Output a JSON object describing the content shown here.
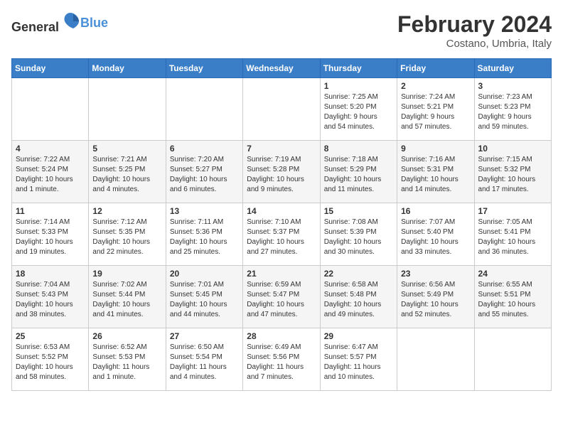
{
  "header": {
    "logo": {
      "text_general": "General",
      "text_blue": "Blue"
    },
    "title": "February 2024",
    "location": "Costano, Umbria, Italy"
  },
  "weekdays": [
    "Sunday",
    "Monday",
    "Tuesday",
    "Wednesday",
    "Thursday",
    "Friday",
    "Saturday"
  ],
  "weeks": [
    [
      {
        "day": "",
        "content": ""
      },
      {
        "day": "",
        "content": ""
      },
      {
        "day": "",
        "content": ""
      },
      {
        "day": "",
        "content": ""
      },
      {
        "day": "1",
        "content": "Sunrise: 7:25 AM\nSunset: 5:20 PM\nDaylight: 9 hours\nand 54 minutes."
      },
      {
        "day": "2",
        "content": "Sunrise: 7:24 AM\nSunset: 5:21 PM\nDaylight: 9 hours\nand 57 minutes."
      },
      {
        "day": "3",
        "content": "Sunrise: 7:23 AM\nSunset: 5:23 PM\nDaylight: 9 hours\nand 59 minutes."
      }
    ],
    [
      {
        "day": "4",
        "content": "Sunrise: 7:22 AM\nSunset: 5:24 PM\nDaylight: 10 hours\nand 1 minute."
      },
      {
        "day": "5",
        "content": "Sunrise: 7:21 AM\nSunset: 5:25 PM\nDaylight: 10 hours\nand 4 minutes."
      },
      {
        "day": "6",
        "content": "Sunrise: 7:20 AM\nSunset: 5:27 PM\nDaylight: 10 hours\nand 6 minutes."
      },
      {
        "day": "7",
        "content": "Sunrise: 7:19 AM\nSunset: 5:28 PM\nDaylight: 10 hours\nand 9 minutes."
      },
      {
        "day": "8",
        "content": "Sunrise: 7:18 AM\nSunset: 5:29 PM\nDaylight: 10 hours\nand 11 minutes."
      },
      {
        "day": "9",
        "content": "Sunrise: 7:16 AM\nSunset: 5:31 PM\nDaylight: 10 hours\nand 14 minutes."
      },
      {
        "day": "10",
        "content": "Sunrise: 7:15 AM\nSunset: 5:32 PM\nDaylight: 10 hours\nand 17 minutes."
      }
    ],
    [
      {
        "day": "11",
        "content": "Sunrise: 7:14 AM\nSunset: 5:33 PM\nDaylight: 10 hours\nand 19 minutes."
      },
      {
        "day": "12",
        "content": "Sunrise: 7:12 AM\nSunset: 5:35 PM\nDaylight: 10 hours\nand 22 minutes."
      },
      {
        "day": "13",
        "content": "Sunrise: 7:11 AM\nSunset: 5:36 PM\nDaylight: 10 hours\nand 25 minutes."
      },
      {
        "day": "14",
        "content": "Sunrise: 7:10 AM\nSunset: 5:37 PM\nDaylight: 10 hours\nand 27 minutes."
      },
      {
        "day": "15",
        "content": "Sunrise: 7:08 AM\nSunset: 5:39 PM\nDaylight: 10 hours\nand 30 minutes."
      },
      {
        "day": "16",
        "content": "Sunrise: 7:07 AM\nSunset: 5:40 PM\nDaylight: 10 hours\nand 33 minutes."
      },
      {
        "day": "17",
        "content": "Sunrise: 7:05 AM\nSunset: 5:41 PM\nDaylight: 10 hours\nand 36 minutes."
      }
    ],
    [
      {
        "day": "18",
        "content": "Sunrise: 7:04 AM\nSunset: 5:43 PM\nDaylight: 10 hours\nand 38 minutes."
      },
      {
        "day": "19",
        "content": "Sunrise: 7:02 AM\nSunset: 5:44 PM\nDaylight: 10 hours\nand 41 minutes."
      },
      {
        "day": "20",
        "content": "Sunrise: 7:01 AM\nSunset: 5:45 PM\nDaylight: 10 hours\nand 44 minutes."
      },
      {
        "day": "21",
        "content": "Sunrise: 6:59 AM\nSunset: 5:47 PM\nDaylight: 10 hours\nand 47 minutes."
      },
      {
        "day": "22",
        "content": "Sunrise: 6:58 AM\nSunset: 5:48 PM\nDaylight: 10 hours\nand 49 minutes."
      },
      {
        "day": "23",
        "content": "Sunrise: 6:56 AM\nSunset: 5:49 PM\nDaylight: 10 hours\nand 52 minutes."
      },
      {
        "day": "24",
        "content": "Sunrise: 6:55 AM\nSunset: 5:51 PM\nDaylight: 10 hours\nand 55 minutes."
      }
    ],
    [
      {
        "day": "25",
        "content": "Sunrise: 6:53 AM\nSunset: 5:52 PM\nDaylight: 10 hours\nand 58 minutes."
      },
      {
        "day": "26",
        "content": "Sunrise: 6:52 AM\nSunset: 5:53 PM\nDaylight: 11 hours\nand 1 minute."
      },
      {
        "day": "27",
        "content": "Sunrise: 6:50 AM\nSunset: 5:54 PM\nDaylight: 11 hours\nand 4 minutes."
      },
      {
        "day": "28",
        "content": "Sunrise: 6:49 AM\nSunset: 5:56 PM\nDaylight: 11 hours\nand 7 minutes."
      },
      {
        "day": "29",
        "content": "Sunrise: 6:47 AM\nSunset: 5:57 PM\nDaylight: 11 hours\nand 10 minutes."
      },
      {
        "day": "",
        "content": ""
      },
      {
        "day": "",
        "content": ""
      }
    ]
  ]
}
